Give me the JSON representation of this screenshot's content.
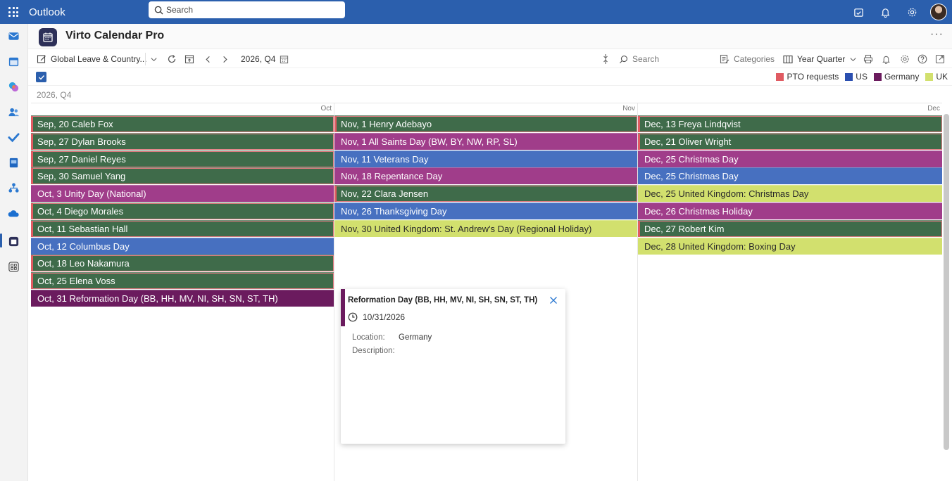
{
  "topbar": {
    "app_name": "Outlook",
    "search_placeholder": "Search"
  },
  "header": {
    "title": "Virto Calendar Pro"
  },
  "toolbar": {
    "calendar_name": "Global Leave & Country...",
    "period": "2026, Q4",
    "search": "Search",
    "categories": "Categories",
    "view": "Year Quarter"
  },
  "legend": [
    {
      "label": "PTO requests",
      "color": "#e05b62"
    },
    {
      "label": "US",
      "color": "#2b4fb0"
    },
    {
      "label": "Germany",
      "color": "#6b1b5e"
    },
    {
      "label": "UK",
      "color": "#d2e06e"
    }
  ],
  "period_label": "2026, Q4",
  "months": [
    "Oct",
    "Nov",
    "Dec"
  ],
  "colors": {
    "pto": "#3f6b4a",
    "us": "#4770c0",
    "germany": "#a03d8a",
    "germany_dark": "#6b1b5e",
    "uk": "#d2e06e"
  },
  "columns": [
    {
      "events": [
        {
          "date": "Sep, 20",
          "title": "Caleb Fox",
          "cat": "pto"
        },
        {
          "date": "Sep, 27",
          "title": "Dylan Brooks",
          "cat": "pto"
        },
        {
          "date": "Sep, 27",
          "title": "Daniel Reyes",
          "cat": "pto"
        },
        {
          "date": "Sep, 30",
          "title": "Samuel Yang",
          "cat": "pto"
        },
        {
          "date": "Oct, 3",
          "title": "Unity Day (National)",
          "cat": "germany"
        },
        {
          "date": "Oct, 4",
          "title": "Diego Morales",
          "cat": "pto"
        },
        {
          "date": "Oct, 11",
          "title": "Sebastian Hall",
          "cat": "pto"
        },
        {
          "date": "Oct, 12",
          "title": "Columbus Day",
          "cat": "us"
        },
        {
          "date": "Oct, 18",
          "title": "Leo Nakamura",
          "cat": "pto"
        },
        {
          "date": "Oct, 25",
          "title": "Elena Voss",
          "cat": "pto"
        },
        {
          "date": "Oct, 31",
          "title": "Reformation Day (BB, HH, MV, NI, SH, SN, ST, TH)",
          "cat": "germany_dark"
        }
      ]
    },
    {
      "events": [
        {
          "date": "Nov, 1",
          "title": "Henry Adebayo",
          "cat": "pto"
        },
        {
          "date": "Nov, 1",
          "title": "All Saints Day (BW, BY, NW, RP, SL)",
          "cat": "germany"
        },
        {
          "date": "Nov, 11",
          "title": "Veterans Day",
          "cat": "us"
        },
        {
          "date": "Nov, 18",
          "title": "Repentance Day",
          "cat": "germany"
        },
        {
          "date": "Nov, 22",
          "title": "Clara Jensen",
          "cat": "pto"
        },
        {
          "date": "Nov, 26",
          "title": "Thanksgiving Day",
          "cat": "us"
        },
        {
          "date": "Nov, 30",
          "title": "United Kingdom: St. Andrew's Day (Regional Holiday)",
          "cat": "uk"
        }
      ]
    },
    {
      "events": [
        {
          "date": "Dec, 13",
          "title": "Freya Lindqvist",
          "cat": "pto"
        },
        {
          "date": "Dec, 21",
          "title": "Oliver Wright",
          "cat": "pto"
        },
        {
          "date": "Dec, 25",
          "title": "Christmas Day",
          "cat": "germany"
        },
        {
          "date": "Dec, 25",
          "title": "Christmas Day",
          "cat": "us"
        },
        {
          "date": "Dec, 25",
          "title": "United Kingdom: Christmas Day",
          "cat": "uk"
        },
        {
          "date": "Dec, 26",
          "title": "Christmas Holiday",
          "cat": "germany"
        },
        {
          "date": "Dec, 27",
          "title": "Robert Kim",
          "cat": "pto"
        },
        {
          "date": "Dec, 28",
          "title": "United Kingdom: Boxing Day",
          "cat": "uk"
        }
      ]
    }
  ],
  "popup": {
    "title": "Reformation Day (BB, HH, MV, NI, SH, SN, ST, TH)",
    "date": "10/31/2026",
    "location_label": "Location:",
    "location_value": "Germany",
    "description_label": "Description:",
    "description_value": ""
  }
}
